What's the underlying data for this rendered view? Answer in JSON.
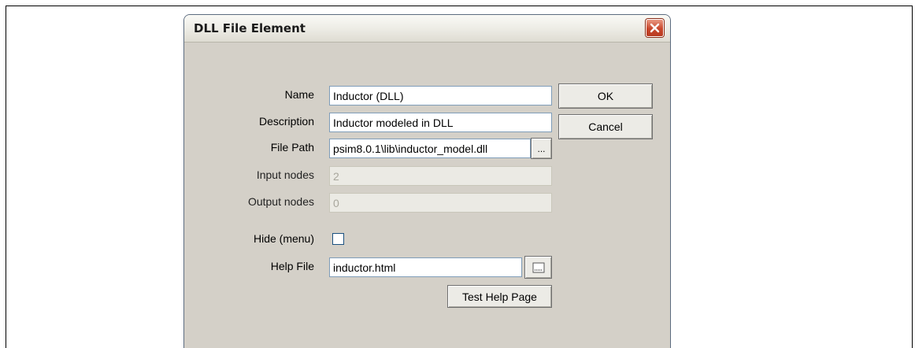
{
  "window": {
    "title": "DLL File Element"
  },
  "form": {
    "name_label": "Name",
    "name_value": "Inductor (DLL)",
    "description_label": "Description",
    "description_value": "Inductor modeled in DLL",
    "file_path_label": "File Path",
    "file_path_value": "psim8.0.1\\lib\\inductor_model.dll",
    "browse_label": "...",
    "input_nodes_label": "Input nodes",
    "input_nodes_value": "2",
    "output_nodes_label": "Output nodes",
    "output_nodes_value": "0",
    "hide_menu_label": "Hide (menu)",
    "hide_menu_checked": false,
    "help_file_label": "Help File",
    "help_file_value": "inductor.html",
    "test_help_label": "Test Help Page"
  },
  "buttons": {
    "ok_label": "OK",
    "cancel_label": "Cancel"
  },
  "icons": {
    "close": "close-icon",
    "help_browse": "browse-icon"
  },
  "colors": {
    "close_button": "#c9462b",
    "field_border": "#7f9db9",
    "dialog_bg": "#d4d0c8"
  }
}
